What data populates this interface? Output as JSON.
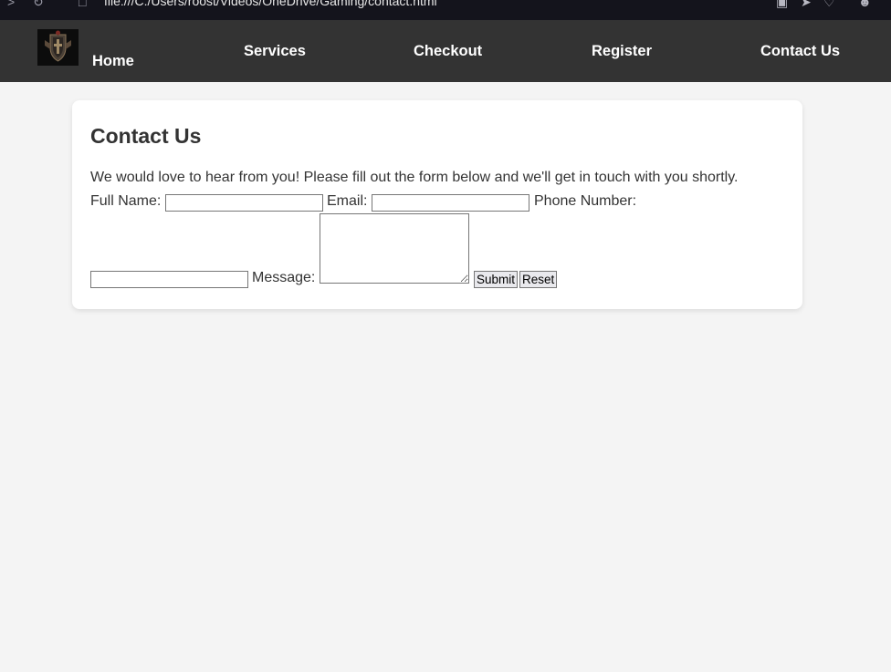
{
  "browser": {
    "url": "file:///C:/Users/roost/Videos/OneDrive/Gaming/contact.html"
  },
  "header": {
    "logo_icon": "shield-crest-icon",
    "nav": [
      {
        "label": "Home"
      },
      {
        "label": "Services"
      },
      {
        "label": "Checkout"
      },
      {
        "label": "Register"
      },
      {
        "label": "Contact Us"
      }
    ]
  },
  "contact": {
    "title": "Contact Us",
    "intro": "We would love to hear from you! Please fill out the form below and we'll get in touch with you shortly.",
    "full_name_label": "Full Name:",
    "full_name_value": "",
    "email_label": "Email:",
    "email_value": "",
    "phone_label": "Phone Number:",
    "phone_value": "",
    "message_label": "Message:",
    "message_value": "",
    "submit_label": "Submit",
    "reset_label": "Reset"
  },
  "colors": {
    "page_bg": "#f4f4f4",
    "header_bg": "#333333",
    "card_bg": "#ffffff",
    "text": "#333333",
    "nav_text": "#ffffff"
  }
}
